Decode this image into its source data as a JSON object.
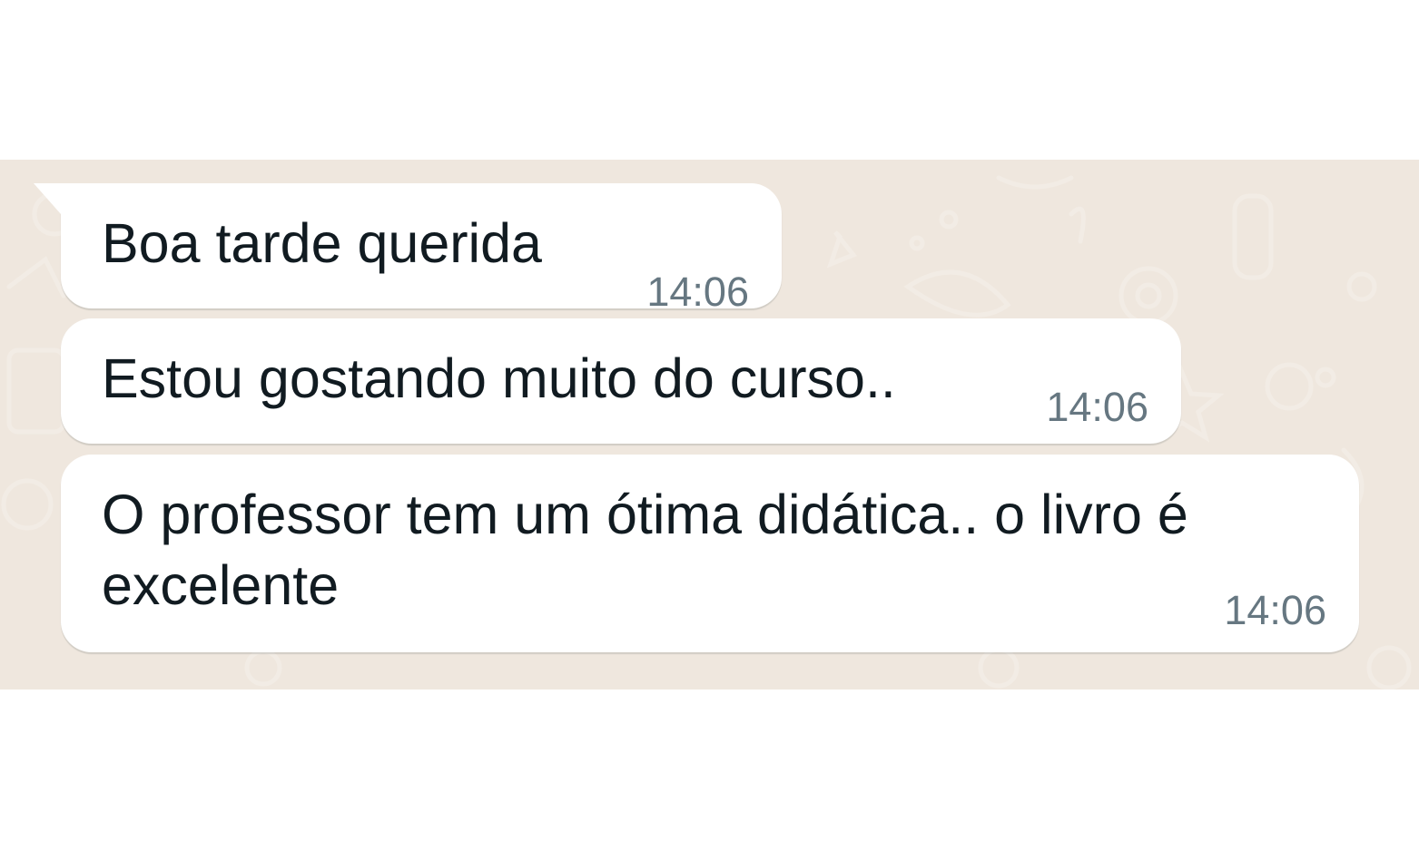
{
  "messages": [
    {
      "text": "Boa tarde querida",
      "time": "14:06"
    },
    {
      "text": "Estou gostando muito do curso..",
      "time": "14:06"
    },
    {
      "text": "O professor tem um ótima didática.. o livro é excelente",
      "time": "14:06"
    }
  ],
  "colors": {
    "chat_background": "#efe7de",
    "bubble": "#ffffff",
    "text": "#111b21",
    "time": "#667781"
  }
}
